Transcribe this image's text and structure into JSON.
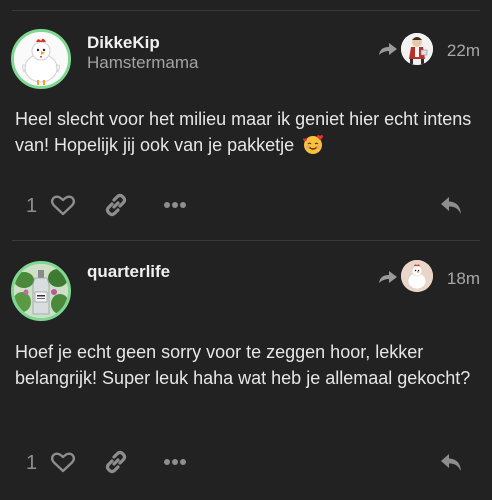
{
  "posts": [
    {
      "username": "DikkeKip",
      "user_title": "Hamstermama",
      "timestamp": "22m",
      "body": "Heel slecht voor het milieu maar ik geniet hier echt intens van! Hopelijk jij ook van je pakketje",
      "emoji": "smiling-face-with-hearts",
      "like_count": "1",
      "reply_to_avatar": "illustrated-character-avatar",
      "avatar": "white-chicken-avatar"
    },
    {
      "username": "quarterlife",
      "timestamp": "18m",
      "body": "Hoef je echt geen sorry voor te zeggen hoor, lekker belangrijk! Super leuk haha wat heb je allemaal gekocht?",
      "like_count": "1",
      "reply_to_avatar": "white-chicken-avatar",
      "avatar": "gin-bottle-with-plants-avatar"
    }
  ],
  "colors": {
    "background": "#222222",
    "avatar_ring": "#7ed891",
    "divider": "#3a3a3a",
    "icon": "#8e8e8e",
    "text": "#e6e6e6",
    "muted": "#a3a3a3"
  }
}
